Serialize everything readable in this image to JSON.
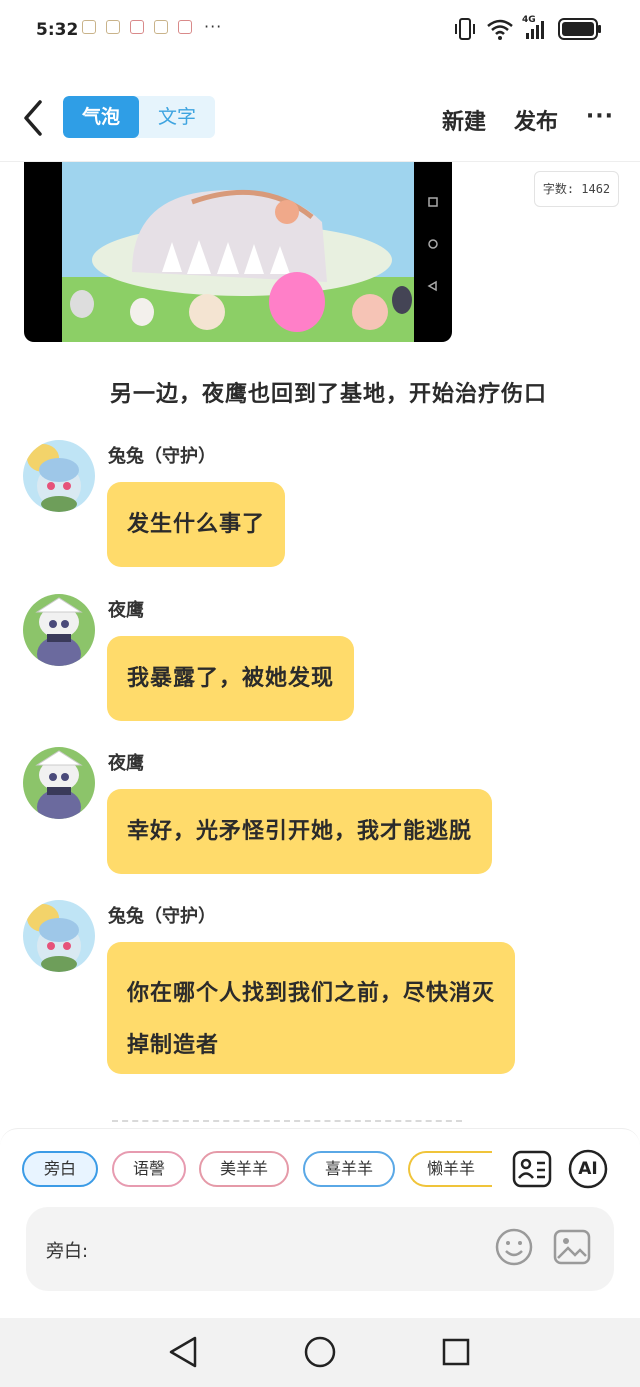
{
  "status": {
    "time": "5:32",
    "more": "···",
    "network": "4G",
    "icons": [
      "vibrate-icon",
      "wifi-icon",
      "signal-icon",
      "battery-icon"
    ]
  },
  "header": {
    "tabs": [
      {
        "label": "气泡",
        "active": true
      },
      {
        "label": "文字",
        "active": false
      }
    ],
    "new_label": "新建",
    "publish_label": "发布",
    "more_label": "···"
  },
  "video": {
    "caption": "",
    "nav_icons": [
      "square-icon",
      "circle-icon",
      "triangle-icon"
    ]
  },
  "word_count": "字数: 1462",
  "narration": "另一边，夜鹰也回到了基地，开始治疗伤口",
  "messages": [
    {
      "name": "兔兔（守护）",
      "text": "发生什么事了",
      "avatar": "rabbit-avatar"
    },
    {
      "name": "夜鹰",
      "text": "我暴露了，被她发现",
      "avatar": "nighthawk-avatar"
    },
    {
      "name": "夜鹰",
      "text": "幸好，光矛怪引开她，我才能逃脱",
      "avatar": "nighthawk-avatar"
    },
    {
      "name": "兔兔（守护）",
      "text_line1": "你在哪个人找到我们之前，尽快消灭",
      "text_line2": "掉制造者",
      "avatar": "rabbit-avatar"
    }
  ],
  "composer": {
    "chips": [
      {
        "label": "旁白",
        "color": "#3b9be6",
        "selected": true
      },
      {
        "label": "语謦",
        "color": "#e79bb0",
        "selected": false
      },
      {
        "label": "美羊羊",
        "color": "#e59aa8",
        "selected": false
      },
      {
        "label": "喜羊羊",
        "color": "#5aa8e6",
        "selected": false
      },
      {
        "label": "懒羊羊",
        "color": "#f0c43a",
        "selected": false
      }
    ],
    "ai_label": "AI",
    "input_label": "旁白:",
    "input_value": "",
    "input_placeholder": ""
  },
  "colors": {
    "accent": "#2f9ee6",
    "bubble": "#ffdb6b"
  }
}
